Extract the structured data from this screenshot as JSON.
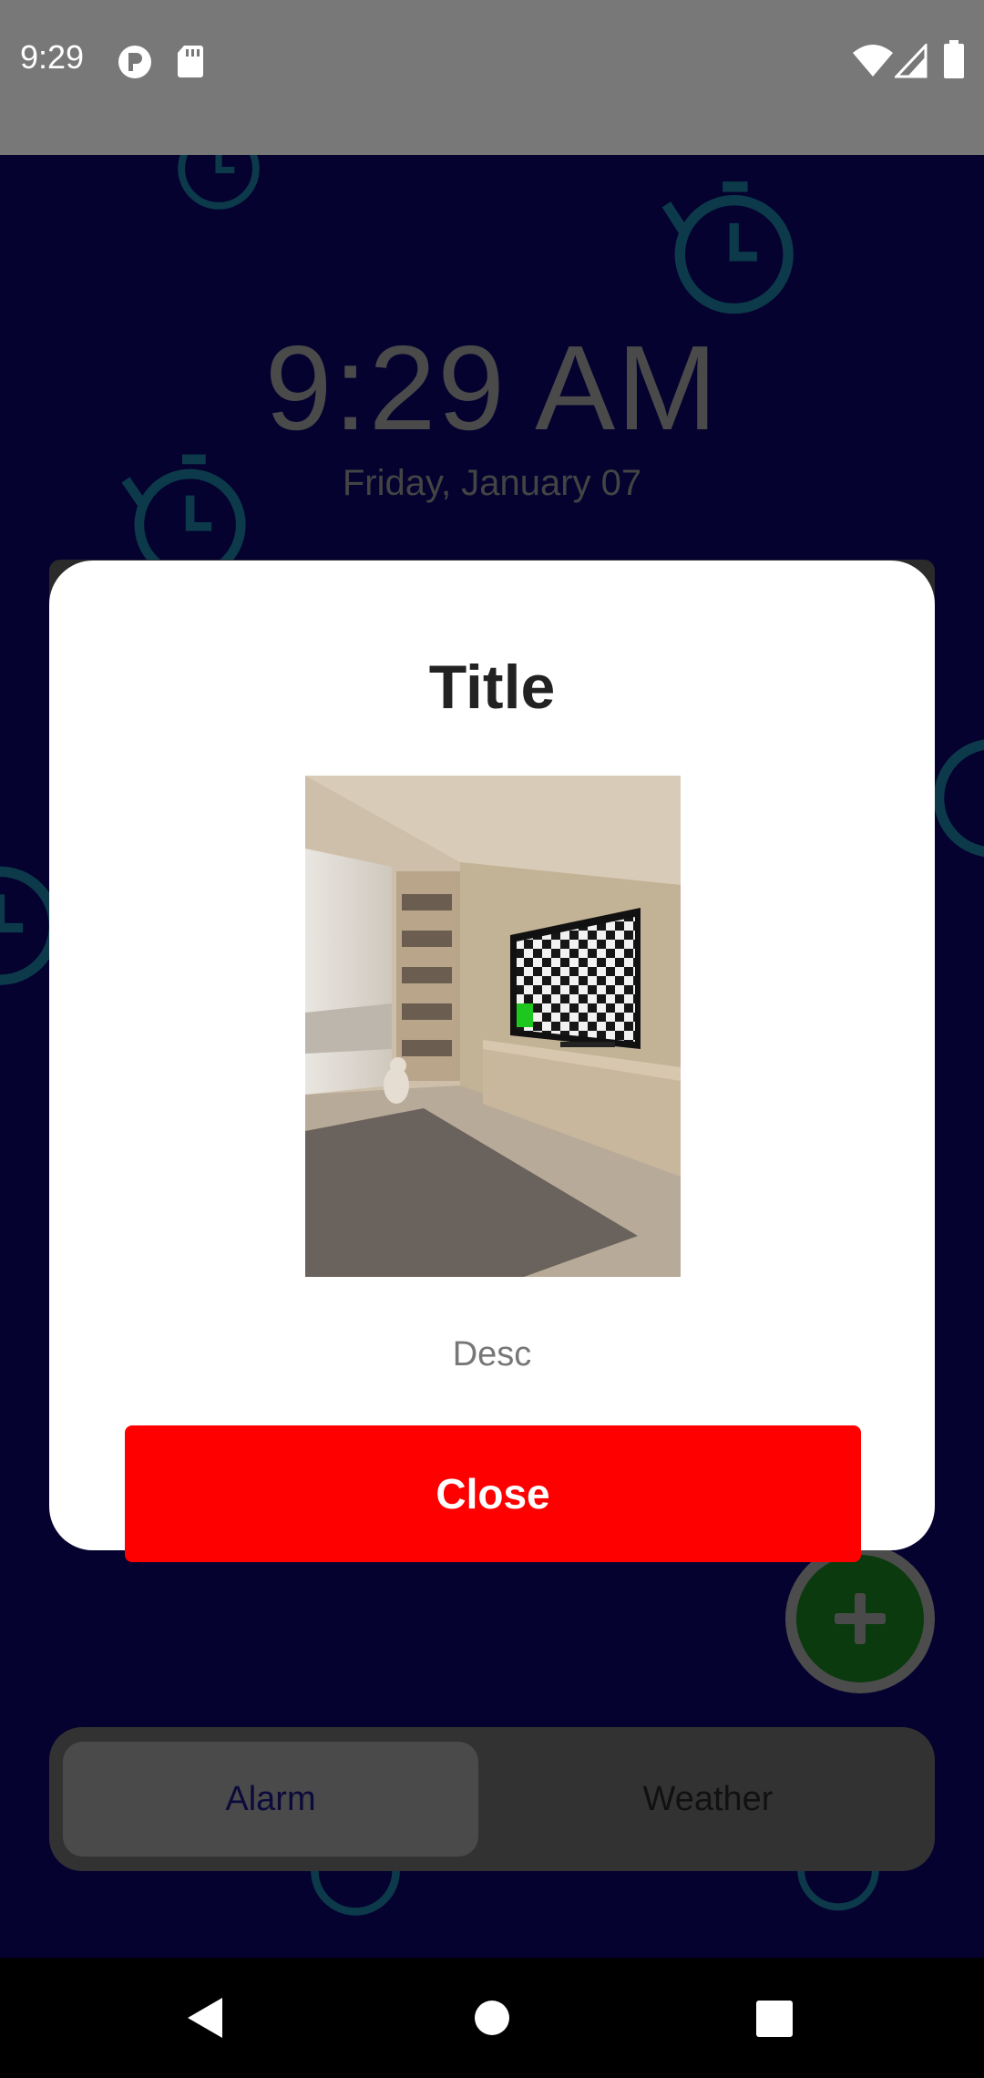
{
  "status_bar": {
    "time": "9:29",
    "icons": [
      "notification-p-icon",
      "sd-card-icon",
      "wifi-icon",
      "signal-icon",
      "battery-icon"
    ]
  },
  "clock": {
    "time": "9:29 AM",
    "date": "Friday, January 07"
  },
  "dialog": {
    "title": "Title",
    "image": "room-with-tv-checkerboard",
    "description": "Desc",
    "close_label": "Close",
    "close_color": "#ff0000"
  },
  "fab": {
    "icon": "plus-icon",
    "color": "#0b3a0e"
  },
  "tabs": [
    {
      "label": "Alarm",
      "selected": true
    },
    {
      "label": "Weather",
      "selected": false
    }
  ],
  "nav_bar": {
    "icons": [
      "back-icon",
      "home-icon",
      "recents-icon"
    ]
  },
  "colors": {
    "background": "#050230",
    "watermark": "#0c3a4a",
    "status_bar": "#787878"
  }
}
